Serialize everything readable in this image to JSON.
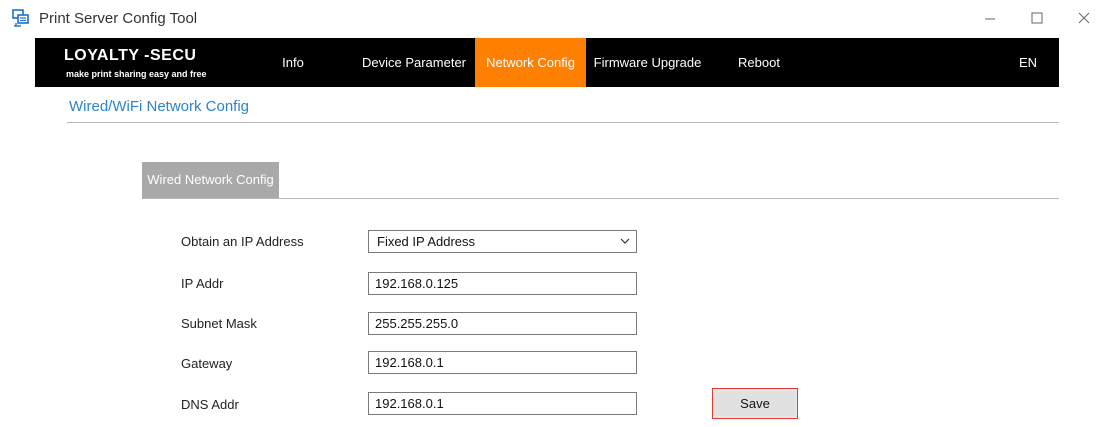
{
  "window": {
    "title": "Print Server Config Tool",
    "icon": "printer-network-icon",
    "controls": [
      "minimize-icon",
      "maximize-icon",
      "close-icon"
    ]
  },
  "brand": {
    "name": "LOYALTY -SECU",
    "tagline": "make print sharing easy and free"
  },
  "nav": {
    "tabs": [
      {
        "label": "Info",
        "active": false
      },
      {
        "label": "Device Parameter",
        "active": false
      },
      {
        "label": "Network Config",
        "active": true
      },
      {
        "label": "Firmware Upgrade",
        "active": false
      },
      {
        "label": "Reboot",
        "active": false
      }
    ],
    "language": "EN"
  },
  "page": {
    "title": "Wired/WiFi Network Config",
    "section_tab": "Wired Network Config"
  },
  "form": {
    "obtain_ip": {
      "label": "Obtain an IP Address",
      "value": "Fixed IP Address"
    },
    "ip_addr": {
      "label": "IP Addr",
      "value": "192.168.0.125"
    },
    "subnet_mask": {
      "label": "Subnet Mask",
      "value": "255.255.255.0"
    },
    "gateway": {
      "label": "Gateway",
      "value": "192.168.0.1"
    },
    "dns_addr": {
      "label": "DNS Addr",
      "value": "192.168.0.1"
    },
    "save_label": "Save"
  },
  "colors": {
    "nav_background": "#000000",
    "active_tab": "#ff7f00",
    "title_blue": "#2c84c8",
    "section_tab": "#a9a9a9",
    "save_border": "#e53935"
  }
}
